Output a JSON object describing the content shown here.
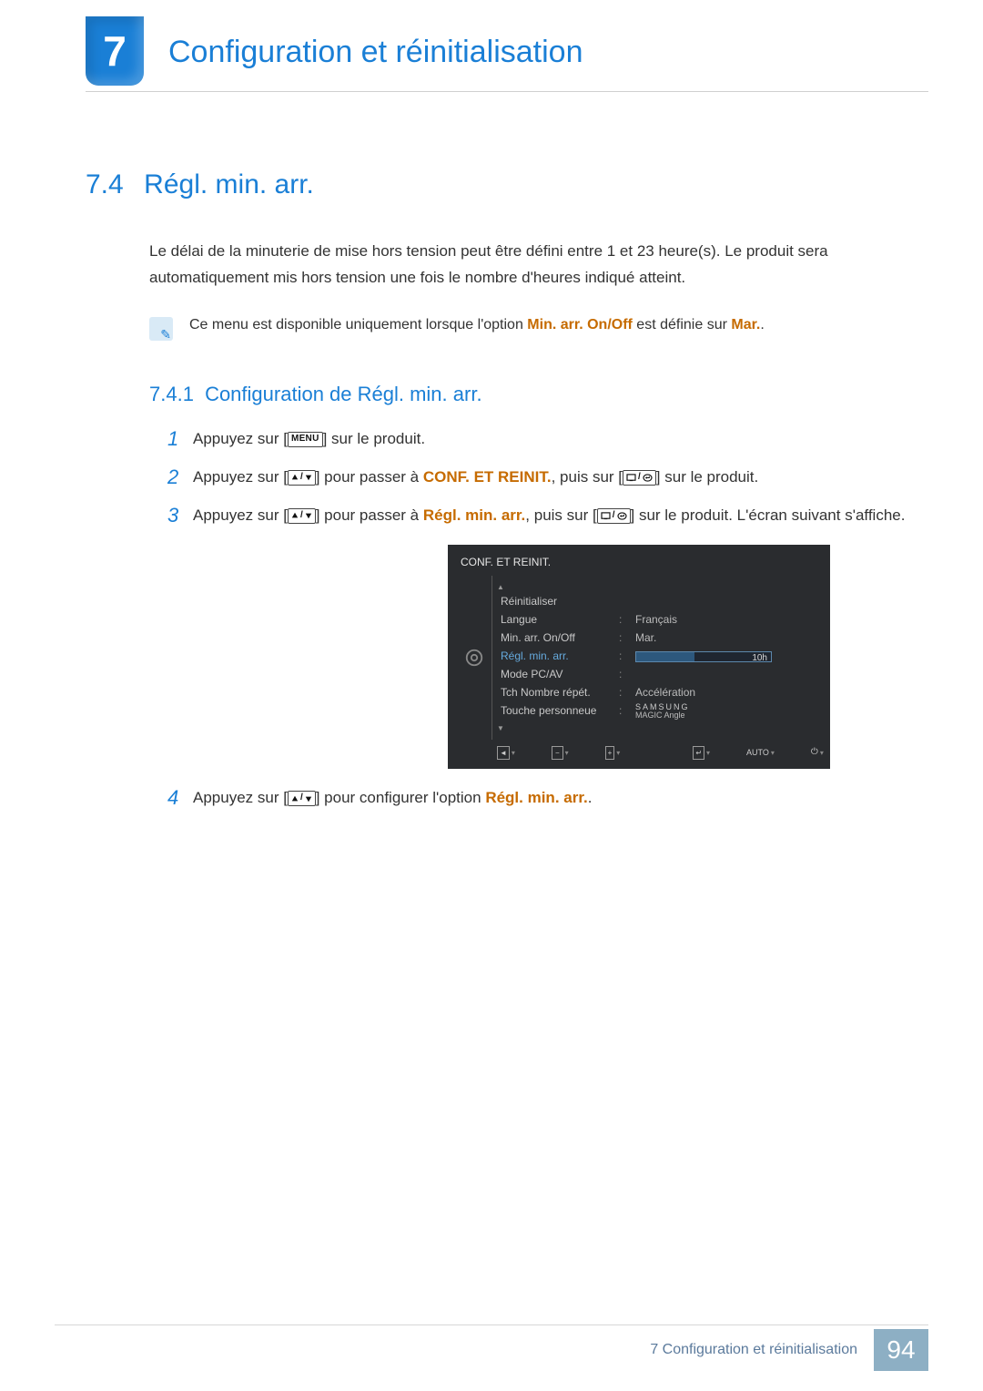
{
  "chapter": {
    "number": "7",
    "title": "Configuration et réinitialisation"
  },
  "section": {
    "number": "7.4",
    "title": "Régl. min. arr."
  },
  "intro": "Le délai de la minuterie de mise hors tension peut être défini entre 1 et 23 heure(s). Le produit sera automatiquement mis hors tension une fois le nombre d'heures indiqué atteint.",
  "note": {
    "pre": "Ce menu est disponible uniquement lorsque l'option ",
    "hl1": "Min. arr. On/Off",
    "mid": " est définie sur ",
    "hl2": "Mar.",
    "post": "."
  },
  "subsection": {
    "number": "7.4.1",
    "title": "Configuration de Régl. min. arr."
  },
  "steps": {
    "s1": {
      "num": "1",
      "t1": "Appuyez sur [",
      "menu": "MENU",
      "t2": "] sur le produit."
    },
    "s2": {
      "num": "2",
      "t1": "Appuyez sur [",
      "t2": "] pour passer à ",
      "hl": "CONF. ET REINIT.",
      "t3": ", puis sur [",
      "t4": "] sur le produit."
    },
    "s3": {
      "num": "3",
      "t1": "Appuyez sur [",
      "t2": "] pour passer à ",
      "hl": "Régl. min. arr.",
      "t3": ", puis sur [",
      "t4": "] sur le produit. L'écran suivant s'affiche."
    },
    "s4": {
      "num": "4",
      "t1": "Appuyez sur [",
      "t2": "] pour configurer l'option ",
      "hl": "Régl. min. arr.",
      "t3": "."
    }
  },
  "osd": {
    "title": "CONF. ET REINIT.",
    "rows": {
      "r0": {
        "lbl": "Réinitialiser"
      },
      "r1": {
        "lbl": "Langue",
        "val": "Français"
      },
      "r2": {
        "lbl": "Min. arr. On/Off",
        "val": "Mar."
      },
      "r3": {
        "lbl": "Régl. min. arr.",
        "slider_value": "10h"
      },
      "r4": {
        "lbl": "Mode PC/AV"
      },
      "r5": {
        "lbl": "Tch Nombre répét.",
        "val": "Accélération"
      },
      "r6": {
        "lbl": "Touche personneue",
        "magic_top": "SAMSUNG",
        "magic_bot": "MAGIC ",
        "magic_tail": "Angle"
      }
    },
    "buttons": {
      "auto": "AUTO"
    }
  },
  "footer": {
    "text": "7 Configuration et réinitialisation",
    "page": "94"
  }
}
